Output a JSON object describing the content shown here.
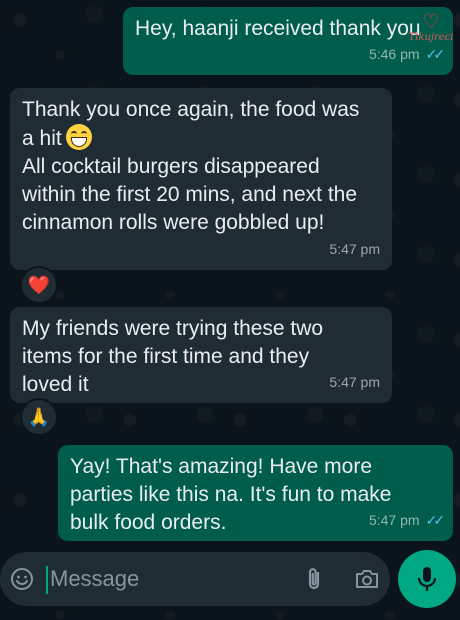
{
  "messages": [
    {
      "text": "Hey, haanji received thank you",
      "time": "5:46 pm",
      "ticks": "✓✓"
    },
    {
      "text": "Thank you once again, the food was\na hit",
      "text2": "All cocktail burgers disappeared\nwithin the first 20 mins, and next the\ncinnamon rolls were gobbled up!",
      "time": "5:47 pm",
      "reaction": "❤️"
    },
    {
      "text": "My friends were trying these two\nitems for the first time and they\nloved it",
      "time": "5:47 pm",
      "reaction": "🙏"
    },
    {
      "text": "Yay! That's amazing! Have more\nparties like this na. It's fun to make\nbulk food orders.",
      "time": "5:47 pm",
      "ticks": "✓✓"
    }
  ],
  "watermark": {
    "text": "Tikujreci"
  },
  "composer": {
    "placeholder": "Message"
  },
  "icons": {
    "emoji": "emoji-icon",
    "attach": "paperclip-icon",
    "camera": "camera-icon",
    "mic": "mic-icon"
  },
  "colors": {
    "outgoing": "#005c4b",
    "incoming": "#202c33",
    "accent": "#00a884",
    "read_ticks": "#53bdeb"
  }
}
